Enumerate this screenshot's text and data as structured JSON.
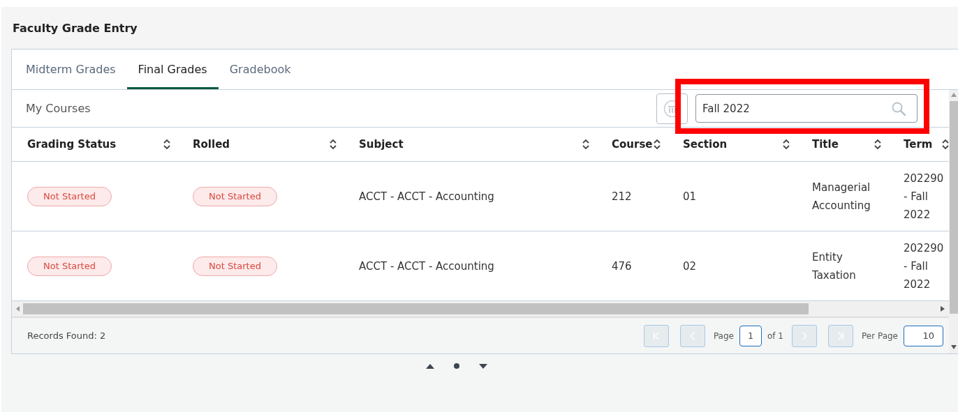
{
  "page": {
    "title": "Faculty Grade Entry"
  },
  "tabs": [
    {
      "label": "Midterm Grades",
      "selected": false
    },
    {
      "label": "Final Grades",
      "selected": true
    },
    {
      "label": "Gradebook",
      "selected": false
    }
  ],
  "section_title": "My Courses",
  "search": {
    "value": "Fall 2022"
  },
  "table": {
    "columns": [
      {
        "label": "Grading Status",
        "kind": "status"
      },
      {
        "label": "Rolled",
        "kind": "status"
      },
      {
        "label": "Subject",
        "kind": "text"
      },
      {
        "label": "Course",
        "kind": "text"
      },
      {
        "label": "Section",
        "kind": "text"
      },
      {
        "label": "Title",
        "kind": "text"
      },
      {
        "label": "Term",
        "kind": "text"
      }
    ],
    "rows": [
      {
        "cells": [
          "Not Started",
          "Not Started",
          "ACCT - ACCT - Accounting",
          "212",
          "01",
          "Managerial Accounting",
          "202290 - Fall 2022"
        ]
      },
      {
        "cells": [
          "Not Started",
          "Not Started",
          "ACCT - ACCT - Accounting",
          "476",
          "02",
          "Entity Taxation",
          "202290 - Fall 2022"
        ]
      }
    ]
  },
  "records_found": "Records Found: 2",
  "pagination": {
    "page_label": "Page",
    "page": "1",
    "of_label": "of 1",
    "per_page_label": "Per Page",
    "per_page": "10"
  }
}
